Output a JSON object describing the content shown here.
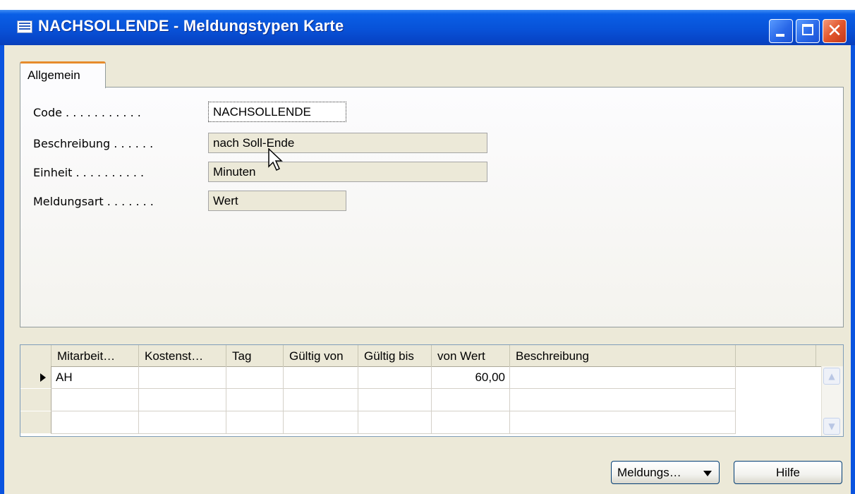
{
  "window": {
    "title": "NACHSOLLENDE - Meldungstypen Karte",
    "title_icon": "form-icon",
    "controls": [
      "minimize-icon",
      "maximize-icon",
      "close-icon"
    ]
  },
  "tabs": [
    {
      "label": "Allgemein",
      "active": true
    }
  ],
  "form": {
    "code_label": "Code . . . . . . . . . . .",
    "code_value": "NACHSOLLENDE",
    "beschreibung_label": "Beschreibung . . . . . .",
    "beschreibung_value": "nach Soll-Ende",
    "einheit_label": "Einheit . . . . . . . . . .",
    "einheit_value": "Minuten",
    "meldungsart_label": "Meldungsart . . . . . . .",
    "meldungsart_value": "Wert"
  },
  "grid": {
    "columns": [
      "Mitarbeit…",
      "Kostenst…",
      "Tag",
      "Gültig von",
      "Gültig bis",
      "von Wert",
      "Beschreibung"
    ],
    "rows": [
      [
        "AH",
        "",
        "",
        "",
        "",
        "60,00",
        ""
      ],
      [
        "",
        "",
        "",
        "",
        "",
        "",
        ""
      ],
      [
        "",
        "",
        "",
        "",
        "",
        "",
        ""
      ]
    ]
  },
  "buttons": {
    "meldungs": "Meldungs…",
    "hilfe": "Hilfe"
  },
  "colors": {
    "titlebar": "#0852d8",
    "client_bg": "#ece9d8",
    "tab_accent": "#e68b2c",
    "close_button": "#e2562c"
  }
}
